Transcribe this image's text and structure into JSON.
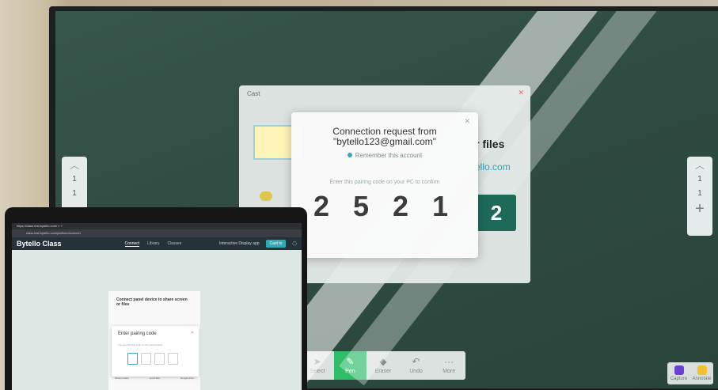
{
  "display": {
    "cast_window": {
      "title": "Cast",
      "heading_partial": "r files",
      "link_partial": "ello.com",
      "code_tile": "2"
    },
    "connection_dialog": {
      "title": "Connection request from",
      "email": "\"bytello123@gmail.com\"",
      "remember_label": "Remember this account",
      "instruction": "Enter this pairing code on your PC to confirm",
      "pairing_code": "2 5 2 1"
    },
    "side_left": {
      "pages": [
        "1",
        "1"
      ]
    },
    "side_right": {
      "pages": [
        "1",
        "1"
      ]
    },
    "toolbar": [
      {
        "label": "Select",
        "icon": "cursor-icon"
      },
      {
        "label": "Pen",
        "icon": "pen-icon",
        "active": true
      },
      {
        "label": "Eraser",
        "icon": "eraser-icon"
      },
      {
        "label": "Undo",
        "icon": "undo-icon"
      },
      {
        "label": "More",
        "icon": "more-icon"
      }
    ],
    "corner": [
      {
        "label": "Capture",
        "color": "#6a3fd6"
      },
      {
        "label": "Annotate",
        "color": "#f2c12e"
      }
    ]
  },
  "laptop": {
    "browser": {
      "tab_title": "https://class.test.bytello.com/ ×  +",
      "address": "class.test.bytello.com/platform/connect"
    },
    "app": {
      "logo": "Bytello Class",
      "nav": [
        "Connect",
        "Library",
        "Classes"
      ],
      "interactive_label": "Interactive Display app",
      "cast_button": "Cast to"
    },
    "share_card": {
      "title": "Connect panel device to share screen or files",
      "options": [
        "Screen share",
        "Local files",
        "Google drive"
      ]
    },
    "pairing_dialog": {
      "title": "Enter pairing code",
      "hint": "You can find this code on the panel device"
    }
  }
}
